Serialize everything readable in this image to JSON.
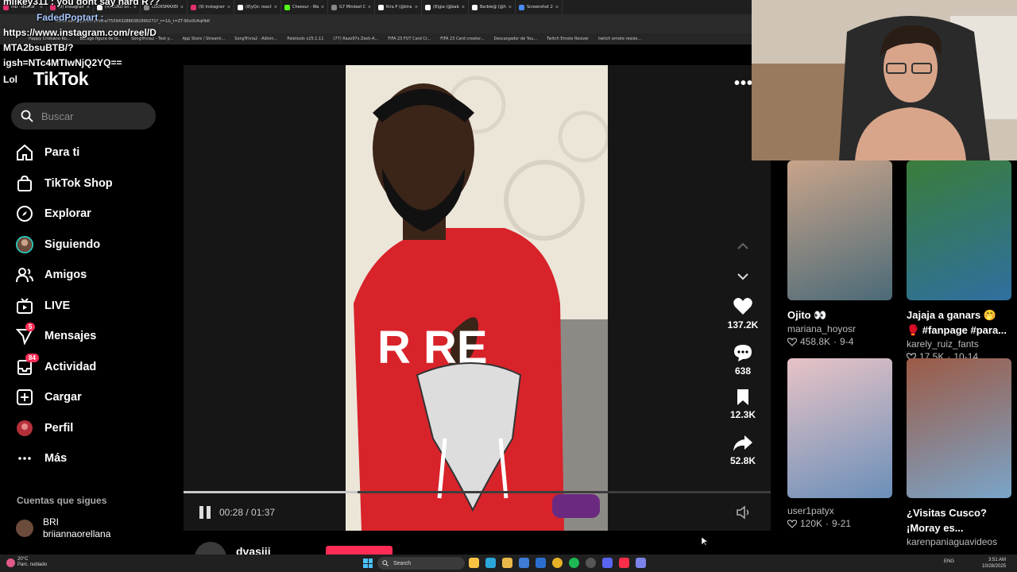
{
  "browser": {
    "tabs": [
      {
        "label": "mb - Buscar",
        "color": "#e1306c"
      },
      {
        "label": "(9) Instagram",
        "color": "#e1306c"
      },
      {
        "label": "(4) ZUKO on X",
        "color": "#ffffff"
      },
      {
        "label": "LOOKSMAXER",
        "color": "#888888"
      },
      {
        "label": "(9) Instagram",
        "color": "#e1306c"
      },
      {
        "label": "(8)yQz: react",
        "color": "#ffffff"
      },
      {
        "label": "Cheesur - Wat",
        "color": "#53fc18"
      },
      {
        "label": "G7 Mindset Co",
        "color": "#888888"
      },
      {
        "label": "Kira P (@kira)",
        "color": "#ffffff"
      },
      {
        "label": "(8)gia (@bab",
        "color": "#ffffff"
      },
      {
        "label": "Barbie@ (@h",
        "color": "#ffffff"
      },
      {
        "label": "Screenshot 20",
        "color": "#4a8cff"
      }
    ],
    "url": "tiktok.com/@dvasiii/video/7559432886382890271?_r=1&_t=ZT-90x0U4qHbK",
    "bookmarks": [
      "Happy Cristiano Ro...",
      "Burago figura de lo...",
      "SongTrivia2 - Test y...",
      "App Store / Streami...",
      "SongTrivia2 - Adivin...",
      "Paletools v25.1.11",
      "(77) Razo97s Zesti-A...",
      "FIFA 23 FUT Card Cr...",
      "FIFA 23 Card creator...",
      "Descargador de You...",
      "Twitch Emote Resizer",
      "twitch emote resize..."
    ]
  },
  "chat": {
    "line1": "milkey311 : you dont say hard R??",
    "name2": "FadedPoptart :",
    "line3": "https://www.instagram.com/reel/D",
    "line4": "MTA2bsuBTB/?",
    "line5": "igsh=NTc4MTIwNjQ2YQ==",
    "line6": "Lol"
  },
  "sidebar": {
    "logo": "TikTok",
    "search_placeholder": "Buscar",
    "items": [
      {
        "label": "Para ti",
        "icon": "home-icon"
      },
      {
        "label": "TikTok Shop",
        "icon": "shop-bag-icon"
      },
      {
        "label": "Explorar",
        "icon": "compass-icon"
      },
      {
        "label": "Siguiendo",
        "icon": "avatar-icon"
      },
      {
        "label": "Amigos",
        "icon": "friends-icon"
      },
      {
        "label": "LIVE",
        "icon": "live-tv-icon"
      },
      {
        "label": "Mensajes",
        "icon": "send-icon",
        "badge": "5"
      },
      {
        "label": "Actividad",
        "icon": "inbox-icon",
        "badge": "84"
      },
      {
        "label": "Cargar",
        "icon": "upload-plus-icon"
      },
      {
        "label": "Perfil",
        "icon": "profile-avatar-icon"
      },
      {
        "label": "Más",
        "icon": "more-dots-icon"
      }
    ],
    "following_title": "Cuentas que sigues",
    "following": [
      {
        "name": "BRI",
        "handle": "briiannaorellana"
      }
    ]
  },
  "player": {
    "time_current": "00:28",
    "time_total": "01:37",
    "progress": 0.297,
    "likes": "137.2K",
    "comments": "638",
    "saves": "12.3K",
    "shares": "52.8K",
    "author": "dvasiii"
  },
  "grid": [
    {
      "title": "Ojito 👀",
      "user": "mariana_hoyosr",
      "likes": "458.8K",
      "date": "9-4",
      "colors": [
        "#c9a48a",
        "#4b6a78"
      ]
    },
    {
      "title": "Jajaja a ganars 🤭 🥊 #fanpage #para...",
      "user": "karely_ruiz_fants",
      "likes": "17.5K",
      "date": "10-14",
      "colors": [
        "#3a7d3a",
        "#2f6fa0"
      ]
    },
    {
      "title": "",
      "user": "user1patyx",
      "likes": "120K",
      "date": "9-21",
      "colors": [
        "#e8c3c6",
        "#6b8fb9"
      ]
    },
    {
      "title": "¿Visitas Cusco? ¡Moray es...",
      "user": "karenpaniaguavideos",
      "likes": "",
      "date": "",
      "colors": [
        "#9c5a45",
        "#7aa5c9"
      ]
    }
  ],
  "taskbar": {
    "weather_temp": "20°C",
    "weather_desc": "Parc. nublado",
    "search": "Search",
    "lang": "ENG",
    "time": "3:51 AM",
    "date": "10/28/2025"
  }
}
